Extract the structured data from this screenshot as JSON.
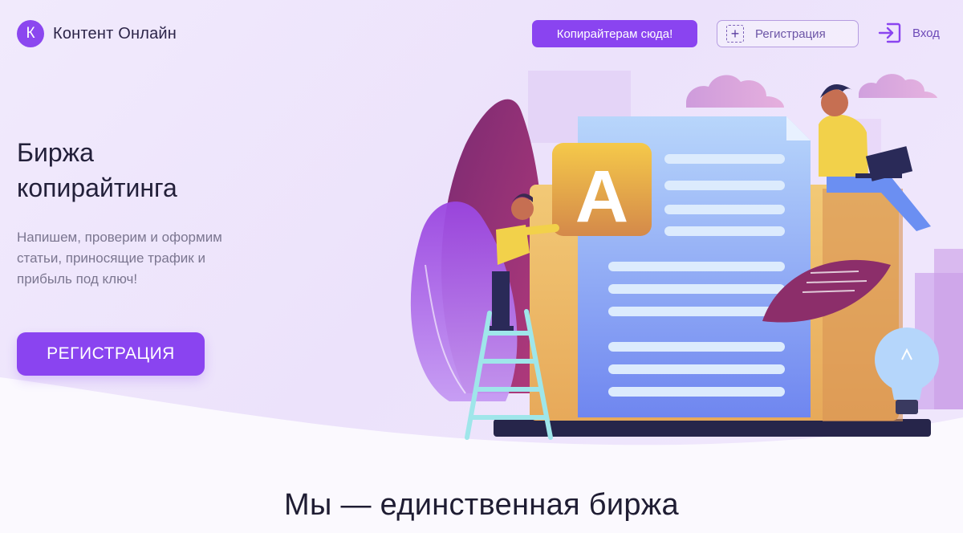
{
  "header": {
    "logo_letter": "К",
    "logo_text": "Контент Онлайн",
    "copywriters_button": "Копирайтерам сюда!",
    "register_button": "Регистрация",
    "login_link": "Вход"
  },
  "hero": {
    "title_line1": "Биржа",
    "title_line2": "копирайтинга",
    "subtitle_line1": "Напишем, проверим и оформим",
    "subtitle_line2": "статьи, приносящие трафик и",
    "subtitle_line3": "прибыль под ключ!",
    "cta_button": "РЕГИСТРАЦИЯ",
    "illustration_letter": "A"
  },
  "section": {
    "heading": "Мы — единственная биржа"
  },
  "colors": {
    "accent": "#8a44f0",
    "background": "#fbf9fe",
    "lavender": "#efe7fb"
  }
}
